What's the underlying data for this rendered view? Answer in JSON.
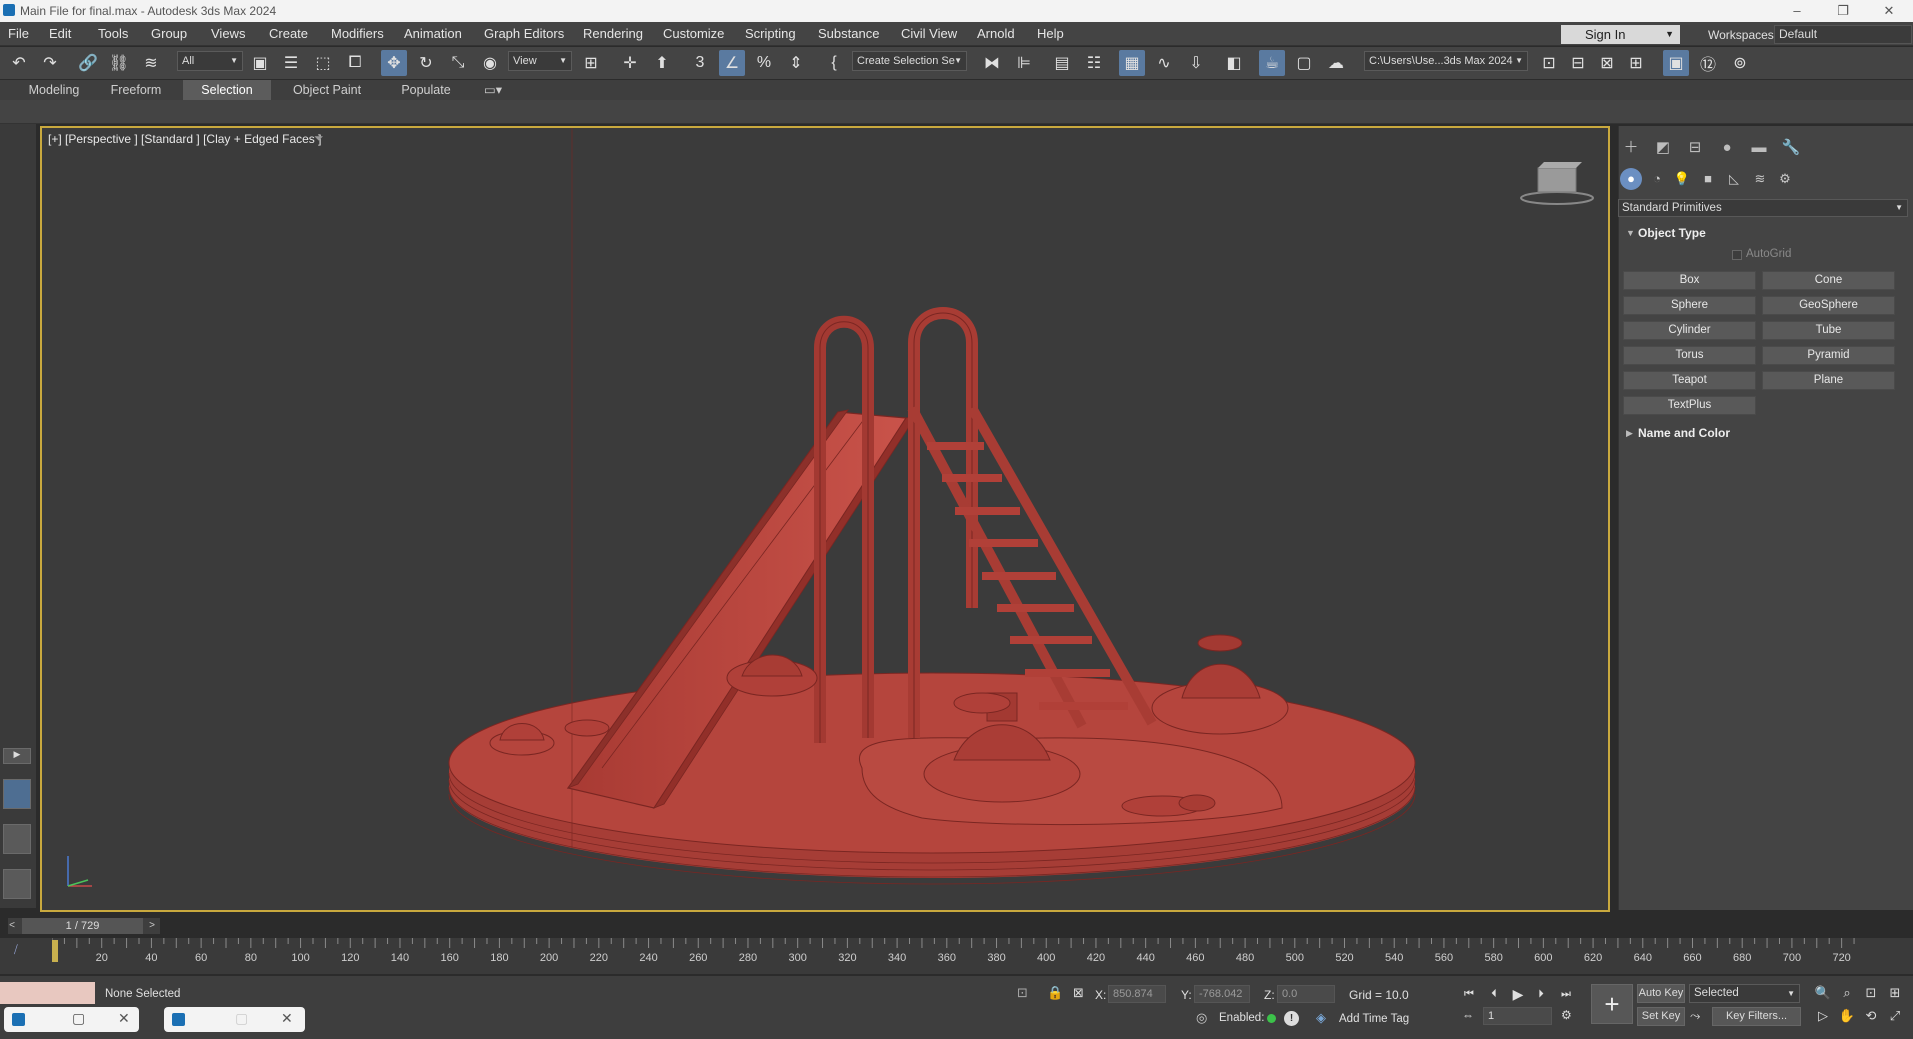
{
  "window": {
    "title": "Main File for final.max - Autodesk 3ds Max 2024",
    "minimize": "–",
    "maximize": "❐",
    "close": "✕"
  },
  "menu": [
    "File",
    "Edit",
    "Tools",
    "Group",
    "Views",
    "Create",
    "Modifiers",
    "Animation",
    "Graph Editors",
    "Rendering",
    "Customize",
    "Scripting",
    "Substance",
    "Civil View",
    "Arnold",
    "Help"
  ],
  "account": {
    "sign_in": "Sign In",
    "workspaces_label": "Workspaces:",
    "workspace_value": "Default"
  },
  "toolbar": {
    "selection_filter": "All",
    "ref_coord": "View",
    "selection_set": "Create Selection Se",
    "project_path": "C:\\Users\\Use...3ds Max 2024"
  },
  "ribbon": {
    "tabs": [
      "Modeling",
      "Freeform",
      "Selection",
      "Object Paint",
      "Populate"
    ],
    "active_tab": "Selection"
  },
  "viewport": {
    "label": "[+] [Perspective ] [Standard ] [Clay + Edged Faces ]",
    "viewcube_label": "",
    "scene_color": "#b5453d",
    "border_color": "#c9a93e"
  },
  "command_panel": {
    "category": "Standard Primitives",
    "object_type_title": "Object Type",
    "autogrid": "AutoGrid",
    "buttons": [
      "Box",
      "Cone",
      "Sphere",
      "GeoSphere",
      "Cylinder",
      "Tube",
      "Torus",
      "Pyramid",
      "Teapot",
      "Plane",
      "TextPlus"
    ],
    "name_color_title": "Name and Color"
  },
  "timeline": {
    "frame_display": "1 / 729",
    "prev": "<",
    "next": ">",
    "tick_labels": [
      "20",
      "40",
      "60",
      "80",
      "100",
      "120",
      "140",
      "160",
      "180",
      "200",
      "220",
      "240",
      "260",
      "280",
      "300",
      "320",
      "340",
      "360",
      "380",
      "400",
      "420",
      "440",
      "460",
      "480",
      "500",
      "520",
      "540",
      "560",
      "580",
      "600",
      "620",
      "640",
      "660",
      "680",
      "700",
      "720"
    ]
  },
  "status": {
    "message": "None Selected",
    "x_label": "X:",
    "x_value": "850.874",
    "y_label": "Y:",
    "y_value": "-768.042",
    "z_label": "Z:",
    "z_value": "0.0",
    "grid": "Grid = 10.0",
    "enabled": "Enabled:",
    "add_time_tag": "Add Time Tag",
    "frame_field": "1",
    "auto_key": "Auto Key",
    "set_key": "Set Key",
    "key_mode": "Selected",
    "key_filters": "Key Filters..."
  }
}
